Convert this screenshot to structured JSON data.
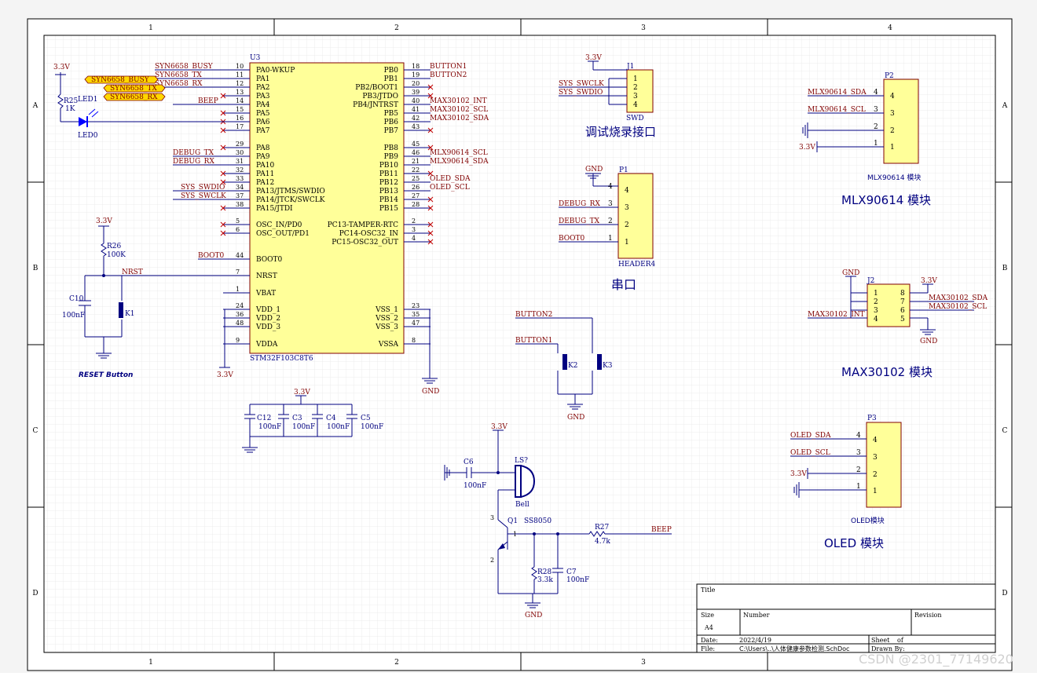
{
  "sheet": {
    "columns": [
      "1",
      "2",
      "3",
      "4"
    ],
    "rows": [
      "A",
      "B",
      "C",
      "D"
    ],
    "watermark": "CSDN @2301_77149620"
  },
  "mcu": {
    "designator": "U3",
    "part": "STM32F103C8T6",
    "left_pins": [
      {
        "num": "10",
        "name": "PA0-WKUP",
        "net": "SYN6658_BUSY"
      },
      {
        "num": "11",
        "name": "PA1",
        "net": "SYN6658_TX"
      },
      {
        "num": "12",
        "name": "PA2",
        "net": "SYN6658_RX"
      },
      {
        "num": "13",
        "name": "PA3",
        "net": ""
      },
      {
        "num": "14",
        "name": "PA4",
        "net": "BEEP"
      },
      {
        "num": "15",
        "name": "PA5",
        "net": ""
      },
      {
        "num": "16",
        "name": "PA6",
        "net": ""
      },
      {
        "num": "17",
        "name": "PA7",
        "net": ""
      },
      {
        "num": "29",
        "name": "PA8",
        "net": ""
      },
      {
        "num": "30",
        "name": "PA9",
        "net": "DEBUG_TX"
      },
      {
        "num": "31",
        "name": "PA10",
        "net": "DEBUG_RX"
      },
      {
        "num": "32",
        "name": "PA11",
        "net": ""
      },
      {
        "num": "33",
        "name": "PA12",
        "net": ""
      },
      {
        "num": "34",
        "name": "PA13/JTMS/SWDIO",
        "net": "SYS_SWDIO"
      },
      {
        "num": "37",
        "name": "PA14/JTCK/SWCLK",
        "net": "SYS_SWCLK"
      },
      {
        "num": "38",
        "name": "PA15/JTDI",
        "net": ""
      },
      {
        "num": "5",
        "name": "OSC_IN/PD0",
        "net": ""
      },
      {
        "num": "6",
        "name": "OSC_OUT/PD1",
        "net": ""
      },
      {
        "num": "44",
        "name": "BOOT0",
        "net": "BOOT0"
      },
      {
        "num": "7",
        "name": "NRST",
        "net": "NRST"
      },
      {
        "num": "1",
        "name": "VBAT",
        "net": ""
      },
      {
        "num": "24",
        "name": "VDD_1",
        "net": ""
      },
      {
        "num": "36",
        "name": "VDD_2",
        "net": ""
      },
      {
        "num": "48",
        "name": "VDD_3",
        "net": ""
      },
      {
        "num": "9",
        "name": "VDDA",
        "net": ""
      }
    ],
    "right_pins": [
      {
        "num": "18",
        "name": "PB0",
        "net": "BUTTON1"
      },
      {
        "num": "19",
        "name": "PB1",
        "net": "BUTTON2"
      },
      {
        "num": "20",
        "name": "PB2/BOOT1",
        "net": ""
      },
      {
        "num": "39",
        "name": "PB3/JTDO",
        "net": ""
      },
      {
        "num": "40",
        "name": "PB4/JNTRST",
        "net": "MAX30102_INT"
      },
      {
        "num": "41",
        "name": "PB5",
        "net": "MAX30102_SCL"
      },
      {
        "num": "42",
        "name": "PB6",
        "net": "MAX30102_SDA"
      },
      {
        "num": "43",
        "name": "PB7",
        "net": ""
      },
      {
        "num": "45",
        "name": "PB8",
        "net": ""
      },
      {
        "num": "46",
        "name": "PB9",
        "net": "MLX90614_SCL"
      },
      {
        "num": "21",
        "name": "PB10",
        "net": "MLX90614_SDA"
      },
      {
        "num": "22",
        "name": "PB11",
        "net": ""
      },
      {
        "num": "25",
        "name": "PB12",
        "net": "OLED_SDA"
      },
      {
        "num": "26",
        "name": "PB13",
        "net": "OLED_SCL"
      },
      {
        "num": "27",
        "name": "PB14",
        "net": ""
      },
      {
        "num": "28",
        "name": "PB15",
        "net": ""
      },
      {
        "num": "2",
        "name": "PC13-TAMPER-RTC",
        "net": ""
      },
      {
        "num": "3",
        "name": "PC14-OSC32_IN",
        "net": ""
      },
      {
        "num": "4",
        "name": "PC15-OSC32_OUT",
        "net": ""
      },
      {
        "num": "23",
        "name": "VSS_1",
        "net": ""
      },
      {
        "num": "35",
        "name": "VSS_2",
        "net": ""
      },
      {
        "num": "47",
        "name": "VSS_3",
        "net": ""
      },
      {
        "num": "8",
        "name": "VSSA",
        "net": ""
      }
    ]
  },
  "labels": {
    "vcc": "3.3V",
    "gnd": "GND",
    "r25": "R25",
    "r25_val": "1K",
    "led1": "LED1",
    "led0": "LED0",
    "r26": "R26",
    "r26_val": "100K",
    "c10": "C10",
    "c10_val": "100nF",
    "k1": "K1",
    "reset_caption": "RESET Button",
    "c12": "C12",
    "c3": "C3",
    "c4": "C4",
    "c5": "C5",
    "cap_val": "100nF",
    "k2": "K2",
    "k3": "K3",
    "c6": "C6",
    "c6_val": "100nF",
    "ls": "LS?",
    "bell": "Bell",
    "q1": "Q1",
    "q1_part": "SS8050",
    "r27": "R27",
    "r27_val": "4.7k",
    "r28": "R28",
    "r28_val": "3.3k",
    "c7": "C7",
    "c7_val": "100nF",
    "beep": "BEEP",
    "button1": "BUTTON1",
    "button2": "BUTTON2",
    "pin1": "1",
    "pin2": "2",
    "pin3": "3"
  },
  "swd": {
    "designator": "J1",
    "part": "SWD",
    "title": "调试烧录接口",
    "net_clk": "SYS_SWCLK",
    "net_dio": "SYS_SWDIO",
    "pins": [
      "1",
      "2",
      "3",
      "4"
    ]
  },
  "uart": {
    "designator": "P1",
    "part": "HEADER4",
    "title": "串口",
    "nets": [
      "GND",
      "DEBUG_RX",
      "DEBUG_TX",
      "BOOT0"
    ],
    "pins": [
      "4",
      "3",
      "2",
      "1"
    ]
  },
  "mlx": {
    "designator": "P2",
    "part": "MLX90614 模块",
    "title": "MLX90614 模块",
    "nets": [
      "MLX90614_SDA",
      "MLX90614_SCL",
      "",
      ""
    ],
    "pins": [
      "4",
      "3",
      "2",
      "1"
    ]
  },
  "max": {
    "designator": "J2",
    "title": "MAX30102 模块",
    "left_pins": [
      "1",
      "2",
      "3",
      "4"
    ],
    "right_pins": [
      "8",
      "7",
      "6",
      "5"
    ],
    "net_int": "MAX30102_INT",
    "net_sda": "MAX30102_SDA",
    "net_scl": "MAX30102_SCL"
  },
  "oled": {
    "designator": "P3",
    "part": "OLED模块",
    "title": "OLED 模块",
    "nets": [
      "OLED_SDA",
      "OLED_SCL",
      "3.3V",
      ""
    ],
    "pins": [
      "4",
      "3",
      "2",
      "1"
    ]
  },
  "title_block": {
    "title_label": "Title",
    "size_label": "Size",
    "size_value": "A4",
    "number_label": "Number",
    "revision_label": "Revision",
    "date_label": "Date:",
    "date_value": "2022/4/19",
    "sheet_label": "Sheet",
    "of_label": "of",
    "file_label": "File:",
    "file_value": "C:\\Users\\..\\人体健康参数检测.SchDoc",
    "drawn_label": "Drawn By:"
  },
  "colors": {
    "wire": "#000080",
    "net_label": "#800000",
    "ic_fill": "#ffff99",
    "ic_border": "#800000",
    "border": "#000000",
    "grid": "#e8e8e8",
    "led": "#0000ff",
    "syn_fill": "#ffd700"
  }
}
